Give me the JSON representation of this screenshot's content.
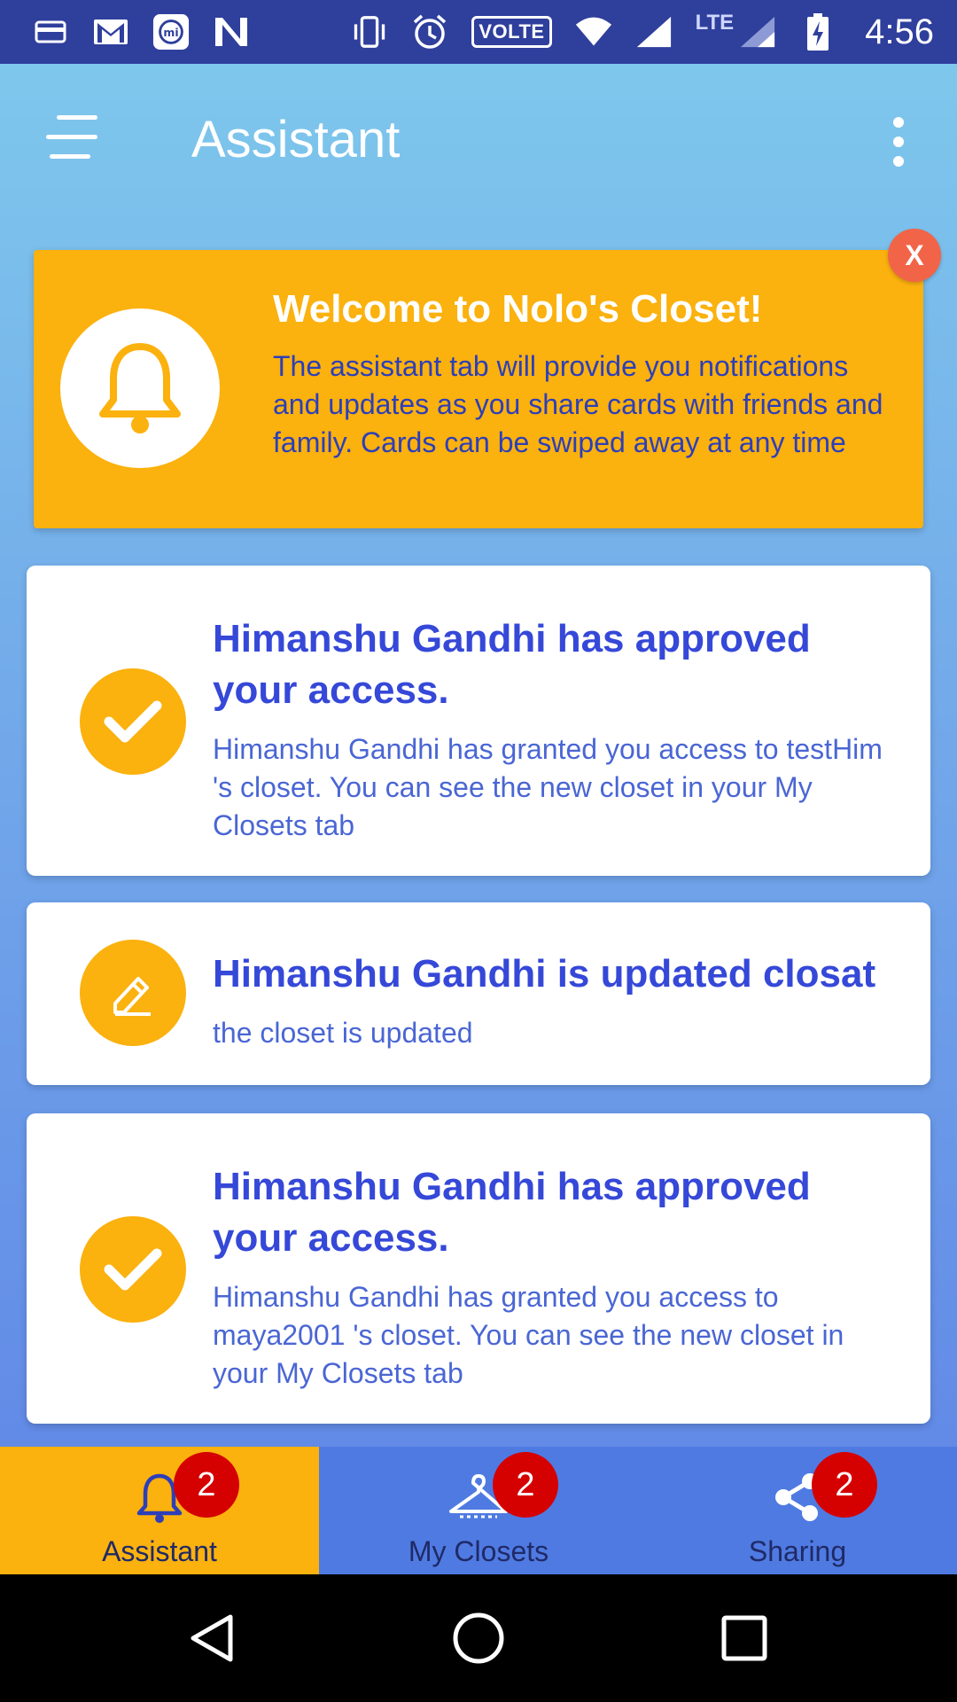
{
  "status_bar": {
    "time": "4:56",
    "volte": "VOLTE",
    "lte": "LTE",
    "icons": [
      "sim-card-icon",
      "gmail-icon",
      "mi-icon",
      "n-app-icon",
      "vibrate-icon",
      "alarm-icon",
      "volte-icon",
      "wifi-icon",
      "signal-icon",
      "battery-charging-icon"
    ]
  },
  "toolbar": {
    "title": "Assistant",
    "menu_icon": "hamburger-menu-icon",
    "more_icon": "more-vert-icon"
  },
  "welcome": {
    "title": "Welcome to Nolo's Closet!",
    "body": "The assistant tab will provide you notifications and updates as you share cards with friends and family. Cards can be swiped away at any time",
    "close_label": "X",
    "icon": "bell-icon"
  },
  "cards": [
    {
      "icon": "check-icon",
      "title": "Himanshu Gandhi has approved your access.",
      "body": "Himanshu Gandhi has granted you access to testHim 's closet. You can see the new closet in your My Closets tab"
    },
    {
      "icon": "edit-icon",
      "title": "Himanshu Gandhi is updated closat",
      "body": "the closet is updated"
    },
    {
      "icon": "check-icon",
      "title": "Himanshu Gandhi has approved your access.",
      "body": "Himanshu Gandhi has granted you access to maya2001 's closet. You can see the new closet in your My Closets tab"
    }
  ],
  "tabs": [
    {
      "label": "Assistant",
      "badge": "2",
      "icon": "bell-icon",
      "active": true
    },
    {
      "label": "My Closets",
      "badge": "2",
      "icon": "hanger-icon",
      "active": false
    },
    {
      "label": "Sharing",
      "badge": "2",
      "icon": "share-icon",
      "active": false
    }
  ],
  "colors": {
    "status_bar": "#2f3f9c",
    "accent_yellow": "#fbb10e",
    "title_blue": "#3548d8",
    "badge_red": "#d50000",
    "tabbar_blue": "#4f7ae2"
  }
}
